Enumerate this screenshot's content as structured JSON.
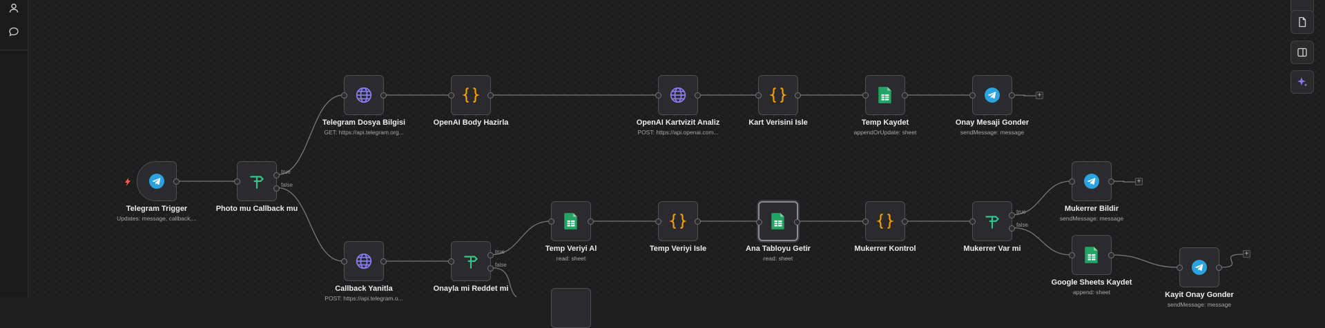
{
  "nodes": [
    {
      "id": "telegram-trigger",
      "label": "Telegram Trigger",
      "sub": "Updates: message, callback,...",
      "icon": "telegram-icon"
    },
    {
      "id": "photo-mu-callback-mu",
      "label": "Photo mu Callback mu",
      "sub": "",
      "icon": "if-icon"
    },
    {
      "id": "telegram-dosya-bilgisi",
      "label": "Telegram Dosya Bilgisi",
      "sub": "GET: https://api.telegram.org...",
      "icon": "globe-icon"
    },
    {
      "id": "openai-body-hazirla",
      "label": "OpenAI Body Hazirla",
      "sub": "",
      "icon": "code-icon"
    },
    {
      "id": "openai-kartvizit-analiz",
      "label": "OpenAI Kartvizit Analiz",
      "sub": "POST: https://api.openai.com...",
      "icon": "globe-icon"
    },
    {
      "id": "kart-verisini-isle",
      "label": "Kart Verisini Isle",
      "sub": "",
      "icon": "code-icon"
    },
    {
      "id": "temp-kaydet",
      "label": "Temp Kaydet",
      "sub": "appendOrUpdate: sheet",
      "icon": "sheets-icon"
    },
    {
      "id": "onay-mesaji-gonder",
      "label": "Onay Mesaji Gonder",
      "sub": "sendMessage: message",
      "icon": "telegram-icon"
    },
    {
      "id": "callback-yanitla",
      "label": "Callback Yanitla",
      "sub": "POST: https://api.telegram.o...",
      "icon": "globe-icon"
    },
    {
      "id": "onayla-mi-reddet-mi",
      "label": "Onayla mi Reddet mi",
      "sub": "",
      "icon": "if-icon"
    },
    {
      "id": "temp-veriyi-al",
      "label": "Temp Veriyi Al",
      "sub": "read: sheet",
      "icon": "sheets-icon"
    },
    {
      "id": "temp-veriyi-isle",
      "label": "Temp Veriyi Isle",
      "sub": "",
      "icon": "code-icon"
    },
    {
      "id": "ana-tabloyu-getir",
      "label": "Ana Tabloyu Getir",
      "sub": "read: sheet",
      "icon": "sheets-icon"
    },
    {
      "id": "mukerrer-kontrol",
      "label": "Mukerrer Kontrol",
      "sub": "",
      "icon": "code-icon"
    },
    {
      "id": "mukerrer-var-mi",
      "label": "Mukerrer Var mi",
      "sub": "",
      "icon": "if-icon"
    },
    {
      "id": "mukerrer-bildir",
      "label": "Mukerrer Bildir",
      "sub": "sendMessage: message",
      "icon": "telegram-icon"
    },
    {
      "id": "google-sheets-kaydet",
      "label": "Google Sheets Kaydet",
      "sub": "append: sheet",
      "icon": "sheets-icon"
    },
    {
      "id": "kayit-onay-gonder",
      "label": "Kayit Onay Gonder",
      "sub": "sendMessage: message",
      "icon": "telegram-icon"
    }
  ],
  "branches": {
    "true_label": "true",
    "false_label": "false"
  },
  "plus_label": "+",
  "left_sidebar": {
    "icons": [
      "user-icon",
      "chat-icon"
    ]
  },
  "right_toolbar": {
    "icons": [
      "document-icon",
      "panel-icon",
      "sparkles-icon"
    ]
  },
  "colors": {
    "canvas": "#1e1e1f",
    "node": "#2b2b2d",
    "telegram": "#2aa3e0",
    "globe": "#8b7cf6",
    "code": "#f59e0b",
    "sheets": "#21a464",
    "if": "#35c58b",
    "trigger_bolt": "#ff5a4f",
    "assistant": "#8b7cf6"
  }
}
